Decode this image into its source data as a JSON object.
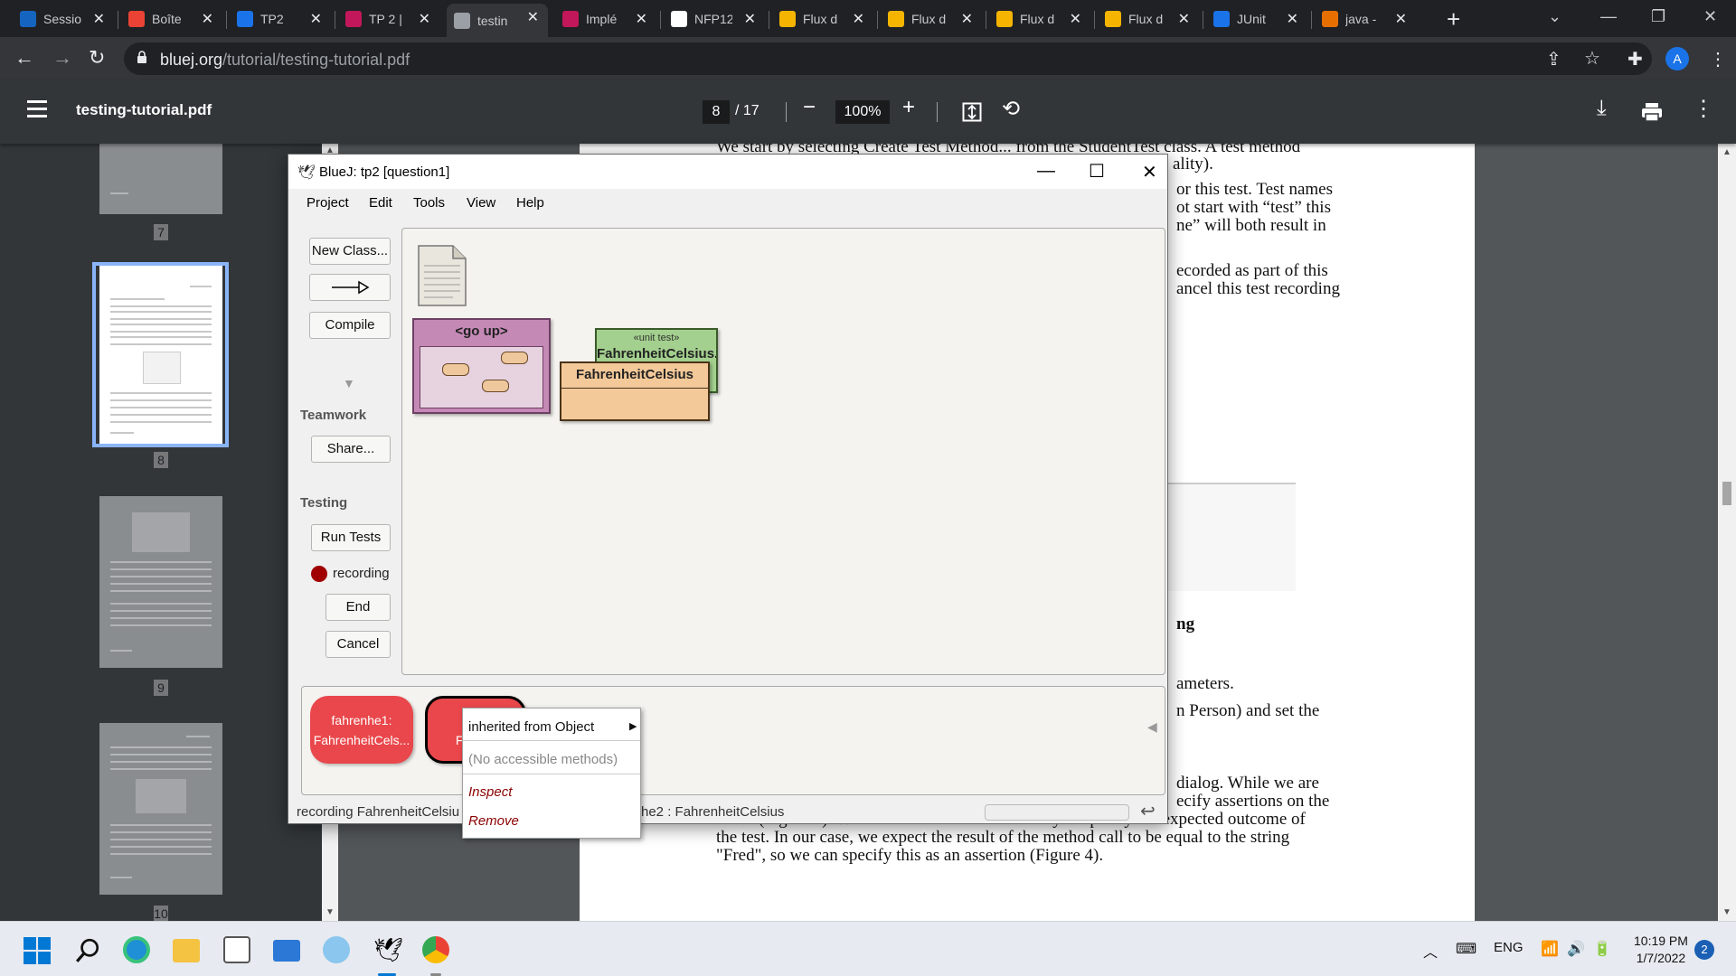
{
  "browser": {
    "tabs": [
      {
        "label": "Sessio",
        "icon": "shield-icon",
        "color": "#1565c0"
      },
      {
        "label": "Boîte",
        "icon": "gmail-icon",
        "color": "#ea4335"
      },
      {
        "label": "TP2",
        "icon": "classroom-icon",
        "color": "#1a73e8"
      },
      {
        "label": "TP 2 |",
        "icon": "cnam-icon",
        "color": "#c2185b"
      },
      {
        "label": "testin",
        "icon": "globe-icon",
        "color": "#9aa0a6"
      },
      {
        "label": "Implé",
        "icon": "cnam-icon",
        "color": "#c2185b"
      },
      {
        "label": "NFP12",
        "icon": "github-icon",
        "color": "#ffffff"
      },
      {
        "label": "Flux d",
        "icon": "slides-icon",
        "color": "#f4b400"
      },
      {
        "label": "Flux d",
        "icon": "slides-icon",
        "color": "#f4b400"
      },
      {
        "label": "Flux d",
        "icon": "slides-icon",
        "color": "#f4b400"
      },
      {
        "label": "Flux d",
        "icon": "slides-icon",
        "color": "#f4b400"
      },
      {
        "label": "JUnit",
        "icon": "tools-icon",
        "color": "#1a73e8"
      },
      {
        "label": "java -",
        "icon": "java-icon",
        "color": "#e76f00"
      }
    ],
    "url_domain": "bluej.org",
    "url_path": "/tutorial/testing-tutorial.pdf",
    "profile_initial": "A"
  },
  "pdf": {
    "filename": "testing-tutorial.pdf",
    "current_page": "8",
    "total_pages": "/ 17",
    "zoom": "100%",
    "thumb_numbers": [
      "7",
      "8",
      "9",
      "10"
    ],
    "visible_text": [
      "We start by selecting Create Test Method... from the StudentTest class. A test method",
      "ality).",
      "or this test. Test names",
      "ot start with “test” this",
      "ne” will both result in",
      "ecorded as part of this",
      "ancel this test recording",
      "ng",
      "ameters.",
      "n Person) and set the",
      "dialog. While we are",
      "ecify assertions on the",
      "result (Figure 4). We can use this assertion facility to specify the expected outcome of",
      "the test. In our case, we expect the result of the method call to be equal to the string",
      "\"Fred\", so we can specify this as an assertion (Figure 4)."
    ]
  },
  "bluej": {
    "title": "BlueJ:  tp2  [question1]",
    "menu": [
      "Project",
      "Edit",
      "Tools",
      "View",
      "Help"
    ],
    "buttons": {
      "new_class": "New Class...",
      "compile": "Compile",
      "teamwork_label": "Teamwork",
      "share": "Share...",
      "testing_label": "Testing",
      "run_tests": "Run Tests",
      "recording": "recording",
      "end": "End",
      "cancel": "Cancel"
    },
    "diagram": {
      "package_label": "<go up>",
      "unit_test_stereotype": "«unit test»",
      "unit_test_name": "FahrenheitCelsius...",
      "class_name": "FahrenheitCelsius"
    },
    "objects": [
      {
        "line1": "fahrenhe1:",
        "line2": "FahrenheitCels..."
      },
      {
        "line1": "fahr",
        "line2": "Fahren"
      }
    ],
    "status_left": "recording FahrenheitCelsiu",
    "status_right": "he2 : FahrenheitCelsius",
    "context_menu": {
      "inherited": "inherited from Object",
      "no_methods": "(No accessible methods)",
      "inspect": "Inspect",
      "remove": "Remove"
    }
  },
  "taskbar": {
    "language": "ENG",
    "time": "10:19 PM",
    "date": "1/7/2022",
    "notifications": "2"
  }
}
